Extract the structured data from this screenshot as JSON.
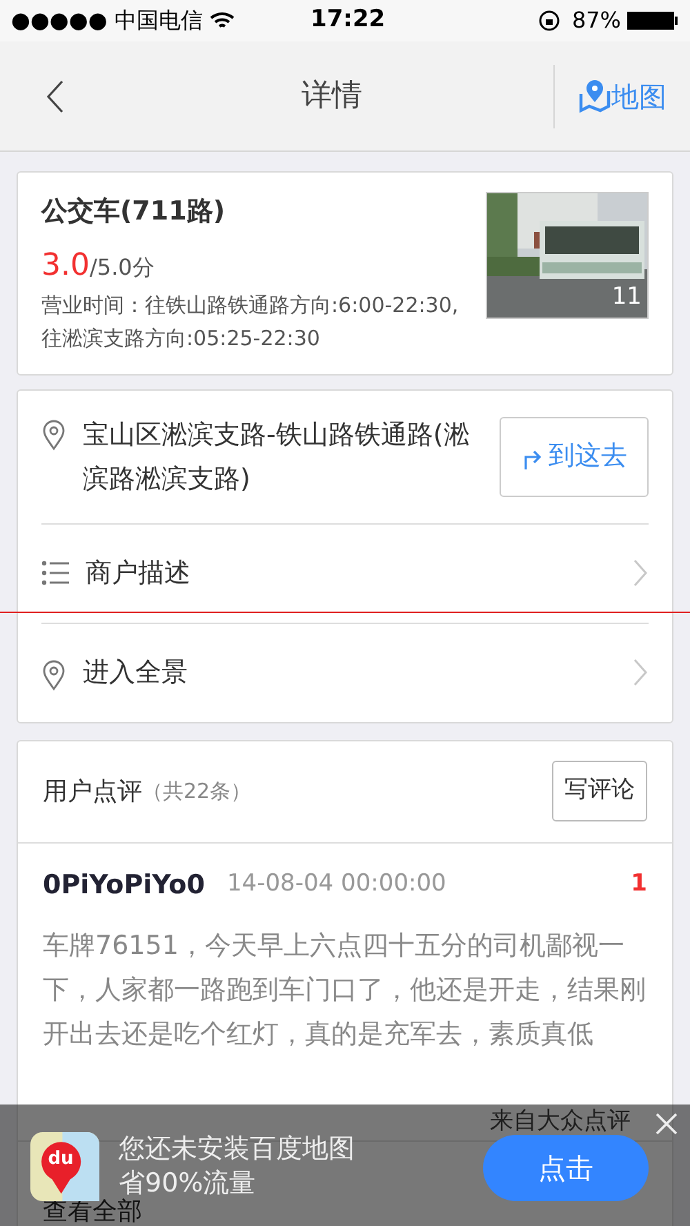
{
  "status_bar": {
    "carrier": "●●●●● 中国电信",
    "time": "17:22",
    "battery": "87%"
  },
  "nav": {
    "title": "详情",
    "map_button": "地图"
  },
  "place": {
    "name": "公交车(711路)",
    "score": "3.0",
    "score_max": "/5.0分",
    "hours": "营业时间：往铁山路铁通路方向:6:00-22:30,往淞滨支路方向:05:25-22:30",
    "photo_count": "11"
  },
  "info_rows": [
    {
      "kind": "address",
      "text": "宝山区淞滨支路-铁山路铁通路(淞滨路淞滨支路)",
      "action": "到这去"
    },
    {
      "kind": "list",
      "text": "商户描述"
    },
    {
      "kind": "pin",
      "text": "进入全景"
    }
  ],
  "reviews": {
    "title": "用户点评",
    "count": "（共22条）",
    "write_button": "写评论",
    "items": [
      {
        "user": "0PiYoPiYo0",
        "date": "14-08-04 00:00:00",
        "badge": "1",
        "text": "车牌76151，今天早上六点四十五分的司机鄙视一下，人家都一路跑到车门口了，他还是开走，结果刚开出去还是吃个红灯，真的是充军去，素质真低"
      }
    ],
    "source": "来自大众点评",
    "view_all": "查看全部"
  },
  "banner": {
    "logo_text": "du",
    "line1": "您还未安装百度地图",
    "line2": "省90%流量",
    "button": "点击"
  }
}
